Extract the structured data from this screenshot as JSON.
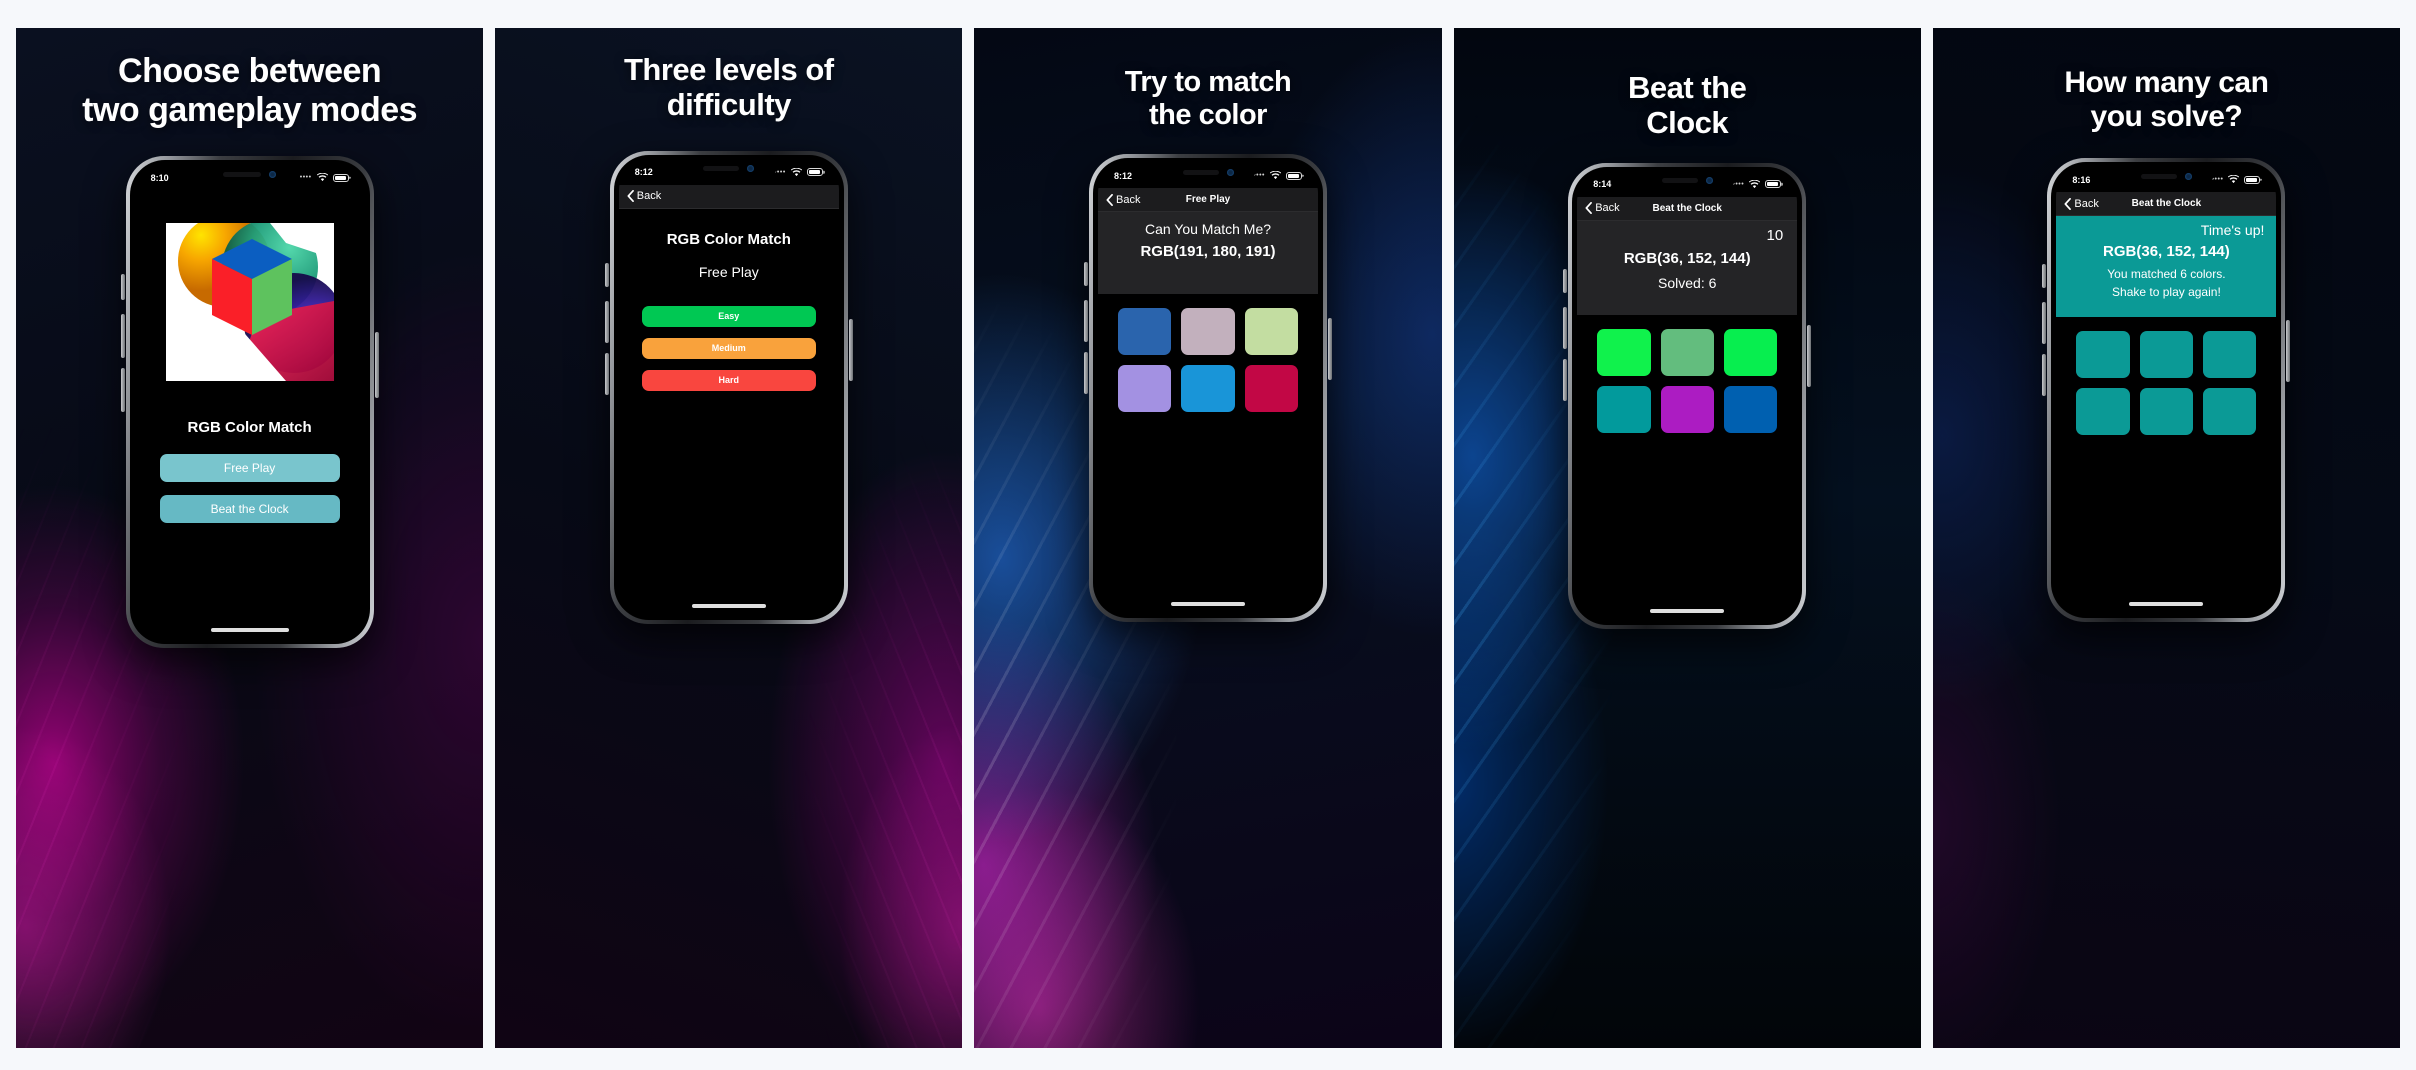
{
  "page": {
    "background": "#f6f8fb"
  },
  "panels": [
    {
      "id": "panel-1",
      "headline": "Choose between\ntwo gameplay modes",
      "headline_line1": "Choose between",
      "headline_line2": "two gameplay modes",
      "status": {
        "time": "8:10",
        "cellular": "••••",
        "wifi": "wifi-icon",
        "battery": "battery-icon"
      },
      "screen_type": "home",
      "app_icon": {
        "name": "rgb-cube-app-icon",
        "colors": {
          "top": "#0b5ec1",
          "left": "#fa1f28",
          "right": "#5ec25e",
          "blob_a": "#f0d000",
          "blob_b": "#2fb38a",
          "blob_c": "#c2185b",
          "blob_d": "#3a2bd6"
        }
      },
      "app_title": "RGB Color Match",
      "buttons": [
        {
          "label": "Free Play",
          "color": "#79c5cd",
          "name": "free-play-button"
        },
        {
          "label": "Beat the Clock",
          "color": "#66b9c4",
          "name": "beat-the-clock-button"
        }
      ]
    },
    {
      "id": "panel-2",
      "headline_line1": "Three levels of",
      "headline_line2": "difficulty",
      "status": {
        "time": "8:12",
        "cellular": "••••",
        "wifi": "wifi-icon",
        "battery": "battery-icon"
      },
      "screen_type": "difficulty",
      "nav": {
        "back_label": "Back",
        "title": ""
      },
      "app_title": "RGB Color Match",
      "mode_label": "Free Play",
      "buttons": [
        {
          "label": "Easy",
          "color": "#00c853",
          "name": "easy-button"
        },
        {
          "label": "Medium",
          "color": "#f9a23c",
          "name": "medium-button"
        },
        {
          "label": "Hard",
          "color": "#f9463f",
          "name": "hard-button"
        }
      ]
    },
    {
      "id": "panel-3",
      "headline_line1": "Try to match",
      "headline_line2": "the color",
      "status": {
        "time": "8:12",
        "cellular": "••••",
        "wifi": "wifi-icon",
        "battery": "battery-icon"
      },
      "screen_type": "freeplay-game",
      "nav": {
        "back_label": "Back",
        "title": "Free Play"
      },
      "prompt": "Can You Match Me?",
      "target_rgb": "RGB(191, 180, 191)",
      "tiles": [
        {
          "color": "#2a64ad",
          "name": "color-tile-1"
        },
        {
          "color": "#c2b0bd",
          "name": "color-tile-2"
        },
        {
          "color": "#c3dda1",
          "name": "color-tile-3"
        },
        {
          "color": "#a391e2",
          "name": "color-tile-4"
        },
        {
          "color": "#1995d8",
          "name": "color-tile-5"
        },
        {
          "color": "#c20745",
          "name": "color-tile-6"
        }
      ]
    },
    {
      "id": "panel-4",
      "headline_line1": "Beat the",
      "headline_line2": "Clock",
      "status": {
        "time": "8:14",
        "cellular": "••••",
        "wifi": "wifi-icon",
        "battery": "battery-icon"
      },
      "screen_type": "beat-the-clock-game",
      "nav": {
        "back_label": "Back",
        "title": "Beat the Clock"
      },
      "timer": "10",
      "target_rgb": "RGB(36, 152, 144)",
      "solved": "Solved: 6",
      "tiles": [
        {
          "color": "#10f24c",
          "name": "color-tile-1"
        },
        {
          "color": "#63bd7e",
          "name": "color-tile-2"
        },
        {
          "color": "#07ee4f",
          "name": "color-tile-3"
        },
        {
          "color": "#029a9c",
          "name": "color-tile-4"
        },
        {
          "color": "#ac1cc2",
          "name": "color-tile-5"
        },
        {
          "color": "#0060b0",
          "name": "color-tile-6"
        }
      ]
    },
    {
      "id": "panel-5",
      "headline_line1": "How many can",
      "headline_line2": "you solve?",
      "status": {
        "time": "8:16",
        "cellular": "••••",
        "wifi": "wifi-icon",
        "battery": "battery-icon"
      },
      "screen_type": "game-over",
      "nav": {
        "back_label": "Back",
        "title": "Beat the Clock"
      },
      "timeup": "Time's up!",
      "target_rgb": "RGB(36, 152, 144)",
      "result_line1": "You matched 6 colors.",
      "result_line2": "Shake to play again!",
      "banner_color": "#0b9a96",
      "tiles": [
        {
          "color": "#0b9a96",
          "name": "color-tile-1"
        },
        {
          "color": "#0b9a96",
          "name": "color-tile-2"
        },
        {
          "color": "#0b9a96",
          "name": "color-tile-3"
        },
        {
          "color": "#0b9a96",
          "name": "color-tile-4"
        },
        {
          "color": "#0b9a96",
          "name": "color-tile-5"
        },
        {
          "color": "#0b9a96",
          "name": "color-tile-6"
        }
      ]
    }
  ]
}
